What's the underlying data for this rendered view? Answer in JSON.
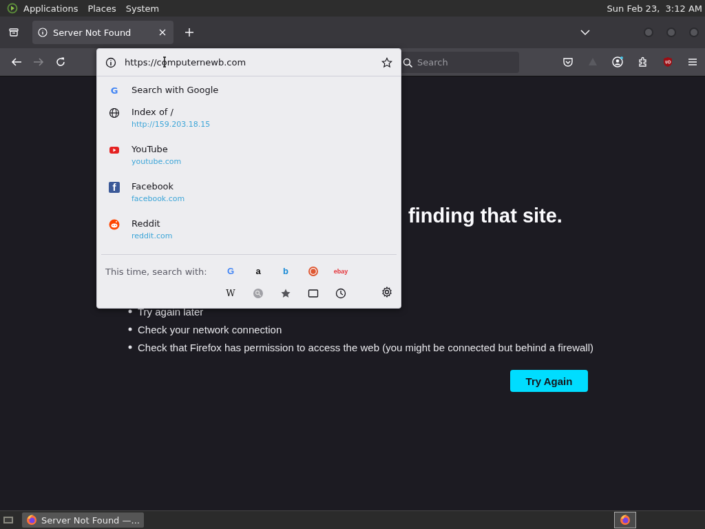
{
  "top_panel": {
    "menus": [
      "Applications",
      "Places",
      "System"
    ],
    "clock": "Sun Feb 23,  3:12 AM"
  },
  "tabs": [
    {
      "title": "Server Not Found",
      "selected": true
    }
  ],
  "navigation": {
    "forward_disabled": true
  },
  "address_bar": {
    "value": "https://computernewb.com"
  },
  "search_field": {
    "placeholder": "Search"
  },
  "suggestions": [
    {
      "kind": "search",
      "badge": "G",
      "title": "Search with Google"
    },
    {
      "kind": "site",
      "title": "Index of /",
      "url": "http://159.203.18.15"
    },
    {
      "kind": "site",
      "title": "YouTube",
      "url": "youtube.com"
    },
    {
      "kind": "site",
      "badge": "f",
      "title": "Facebook",
      "url": "facebook.com"
    },
    {
      "kind": "site",
      "title": "Reddit",
      "url": "reddit.com"
    }
  ],
  "search_shortcuts": {
    "label": "This time, search with:",
    "engines": [
      {
        "kind": "letter",
        "text": "G"
      },
      {
        "kind": "letter",
        "text": "a"
      },
      {
        "kind": "letter",
        "text": "b"
      },
      {
        "kind": "icon"
      },
      {
        "kind": "letter",
        "text": "ebay"
      },
      {
        "kind": "letter",
        "text": "W"
      },
      {
        "kind": "icon"
      },
      {
        "kind": "icon"
      },
      {
        "kind": "icon"
      },
      {
        "kind": "icon"
      }
    ]
  },
  "page": {
    "heading": "finding that site.",
    "tips": [
      "Try again later",
      "Check your network connection",
      "Check that Firefox has permission to access the web (you might be connected but behind a firewall)"
    ],
    "button": "Try Again"
  },
  "taskbar": {
    "windows": [
      {
        "title": "Server Not Found —...",
        "selected": true
      }
    ]
  }
}
